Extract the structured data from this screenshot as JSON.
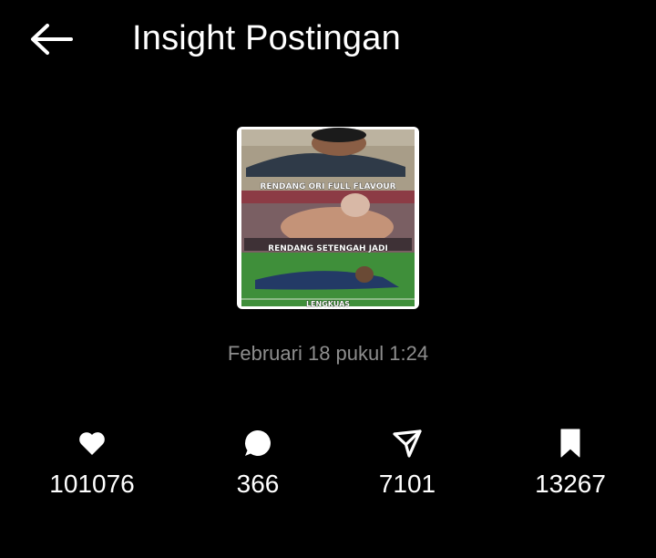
{
  "header": {
    "title": "Insight Postingan",
    "back_icon": "arrow-left-icon"
  },
  "post": {
    "captions": [
      "RENDANG ORI FULL FLAVOUR",
      "RENDANG SETENGAH JADI",
      "LENGKUAS"
    ],
    "timestamp": "Februari 18 pukul 1:24"
  },
  "stats": {
    "likes": {
      "icon": "heart-icon",
      "value": "101076"
    },
    "comments": {
      "icon": "comment-bubble-icon",
      "value": "366"
    },
    "shares": {
      "icon": "send-icon",
      "value": "7101"
    },
    "saves": {
      "icon": "bookmark-icon",
      "value": "13267"
    }
  },
  "colors": {
    "background": "#000000",
    "text": "#ffffff",
    "muted": "#8e8e8e"
  }
}
